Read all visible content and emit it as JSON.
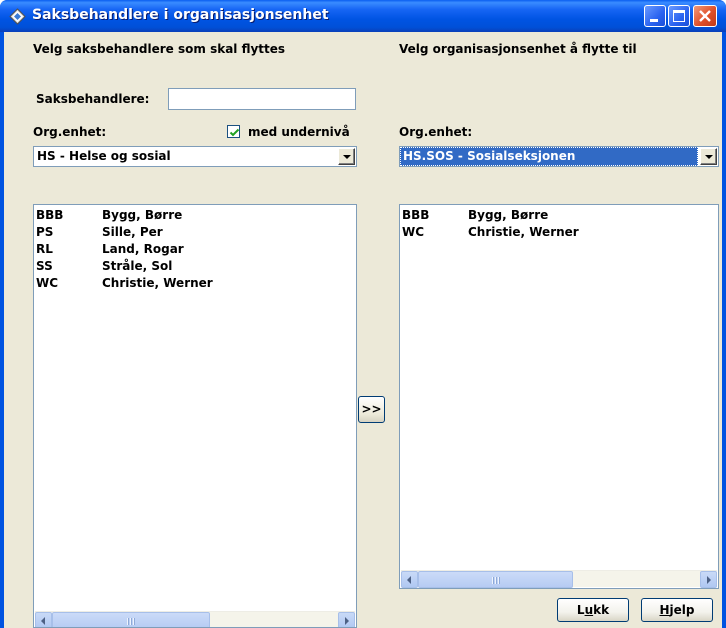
{
  "window": {
    "title": "Saksbehandlere i organisasjonsenhet",
    "icon": "app-diamond-icon"
  },
  "left": {
    "heading": "Velg saksbehandlere som skal flyttes",
    "search_label": "Saksbehandlere:",
    "search_value": "",
    "org_label": "Org.enhet:",
    "subunit_checkbox_label": "med undernivå",
    "subunit_checked": true,
    "org_selected": "HS  -  Helse og sosial",
    "list": [
      {
        "code": "BBB",
        "name": "Bygg, Børre"
      },
      {
        "code": "PS",
        "name": "Sille, Per"
      },
      {
        "code": "RL",
        "name": "Land, Rogar"
      },
      {
        "code": "SS",
        "name": "Stråle, Sol"
      },
      {
        "code": "WC",
        "name": "Christie, Werner"
      }
    ]
  },
  "move_button_label": ">>",
  "right": {
    "heading": "Velg organisasjonsenhet å flytte til",
    "org_label": "Org.enhet:",
    "org_selected": "HS.SOS  -  Sosialseksjonen",
    "list": [
      {
        "code": "BBB",
        "name": "Bygg, Børre"
      },
      {
        "code": "WC",
        "name": "Christie, Werner"
      }
    ]
  },
  "buttons": {
    "close_prefix": "L",
    "close_accel": "u",
    "close_suffix": "kk",
    "help_prefix": "",
    "help_accel": "H",
    "help_suffix": "jelp"
  },
  "colors": {
    "titlebar": "#0054e3",
    "dialog_bg": "#ece9d8",
    "selection": "#316ac5",
    "close_button": "#e0502a"
  }
}
